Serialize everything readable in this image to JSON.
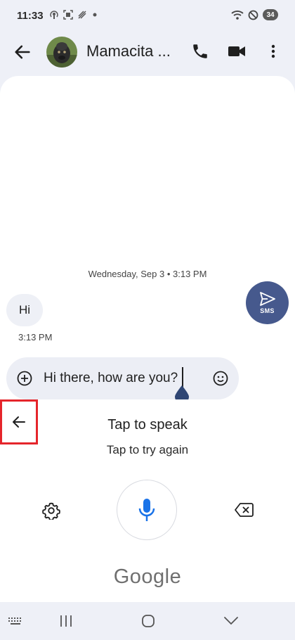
{
  "status_bar": {
    "time": "11:33",
    "battery": "34",
    "icons": [
      "hotspot-icon",
      "screenshot-icon",
      "vibrate-icon",
      "dot-icon",
      "wifi-icon",
      "do-not-disturb-icon",
      "battery-icon"
    ]
  },
  "header": {
    "contact_name": "Mamacita ...",
    "icons": [
      "back-arrow-icon",
      "avatar",
      "phone-icon",
      "video-camera-icon",
      "more-vert-icon"
    ]
  },
  "conversation": {
    "date_separator": "Wednesday, Sep 3 • 3:13 PM",
    "messages": [
      {
        "text": "Hi",
        "time": "3:13 PM",
        "direction": "incoming"
      }
    ]
  },
  "composer": {
    "text": "Hi there, how are you?",
    "send_label": "SMS",
    "icons": [
      "add-circle-icon",
      "emoji-icon",
      "send-icon"
    ]
  },
  "voice_input": {
    "title": "Tap to speak",
    "subtitle": "Tap to try again",
    "brand": "Google",
    "accent_color": "#1a73e8",
    "icons": [
      "back-arrow-icon",
      "settings-gear-icon",
      "microphone-icon",
      "backspace-icon"
    ]
  },
  "nav_bar": {
    "icons": [
      "keyboard-icon",
      "recents-icon",
      "home-icon",
      "chevron-down-icon"
    ]
  },
  "colors": {
    "background": "#eef0f7",
    "send_button": "#46598d",
    "highlight_box": "#e5252b"
  }
}
